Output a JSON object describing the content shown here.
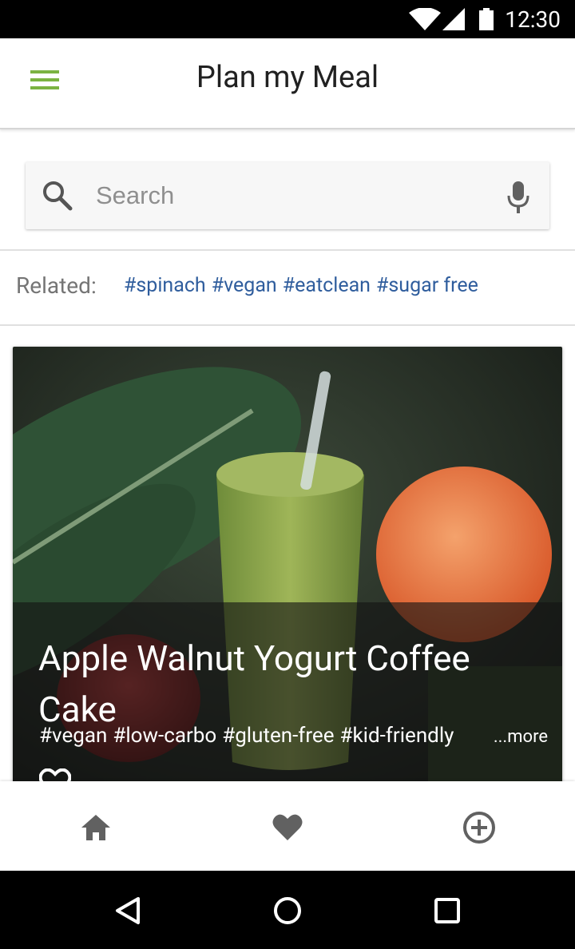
{
  "status_bar": {
    "time": "12:30",
    "icons": [
      "wifi-icon",
      "signal-icon",
      "battery-icon"
    ]
  },
  "app_bar": {
    "title": "Plan my Meal",
    "menu_icon": "menu-icon",
    "accent": "#7cb342"
  },
  "search": {
    "placeholder": "Search",
    "value": "",
    "icons": [
      "search-icon",
      "mic-icon"
    ]
  },
  "related": {
    "label": "Related:",
    "tags": [
      "#spinach",
      "#vegan",
      "#eatclean",
      "#sugar free"
    ],
    "tag_color": "#2f5d9d"
  },
  "card": {
    "title": "Apple Walnut Yogurt Coffee Cake",
    "tags": [
      "#vegan",
      "#low-carbo",
      "#gluten-free",
      "#kid-friendly"
    ],
    "more_label": "...more",
    "like_icon": "heart-outline-icon"
  },
  "bottom_nav": {
    "items": [
      "home-icon",
      "heart-icon",
      "add-circle-icon"
    ],
    "icon_color": "#616161"
  },
  "system_nav": {
    "items": [
      "back-icon",
      "home-circle-icon",
      "recents-icon"
    ]
  }
}
